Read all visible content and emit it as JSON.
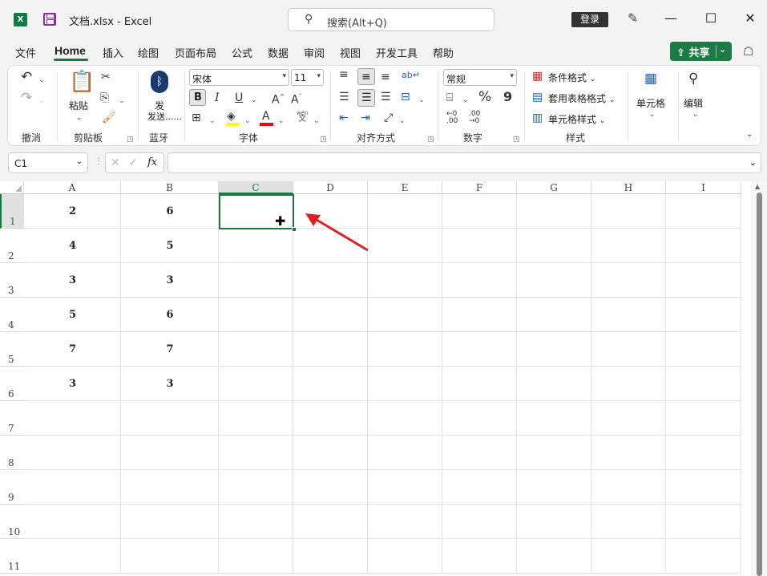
{
  "title_bar": {
    "doc_title": "文档.xlsx  -  Excel",
    "search_placeholder": "搜索(Alt+Q)",
    "login": "登录",
    "minimize": "—",
    "maximize": "☐",
    "close": "✕"
  },
  "menu": {
    "items": [
      "文件",
      "Home",
      "插入",
      "绘图",
      "页面布局",
      "公式",
      "数据",
      "审阅",
      "视图",
      "开发工具",
      "帮助"
    ],
    "active": "Home",
    "share": "共享"
  },
  "ribbon": {
    "groups": [
      "撤消",
      "剪贴板",
      "蓝牙",
      "字体",
      "对齐方式",
      "数字",
      "样式"
    ],
    "paste": "粘贴",
    "bluetooth_send": "发送......",
    "font_name": "宋体",
    "font_size": "11",
    "bold": "B",
    "italic": "I",
    "underline": "U",
    "number_format": "常规",
    "conditional_format": "条件格式",
    "table_format": "套用表格格式",
    "cell_style": "单元格样式",
    "cells": "单元格",
    "editing": "编辑",
    "percent": "%",
    "comma": "9",
    "wen": "wén",
    "wen_char": "文"
  },
  "formula_bar": {
    "name_box": "C1",
    "fx": "fx",
    "value": ""
  },
  "sheet": {
    "columns": [
      "A",
      "B",
      "C",
      "D",
      "E",
      "F",
      "G",
      "H",
      "I"
    ],
    "rows": [
      "1",
      "2",
      "3",
      "4",
      "5",
      "6",
      "7",
      "8",
      "9",
      "10",
      "11"
    ],
    "selected_cell": "C1",
    "data": [
      {
        "a": "2",
        "b": "6"
      },
      {
        "a": "4",
        "b": "5"
      },
      {
        "a": "3",
        "b": "3"
      },
      {
        "a": "5",
        "b": "6"
      },
      {
        "a": "7",
        "b": "7"
      },
      {
        "a": "3",
        "b": "3"
      }
    ]
  },
  "colors": {
    "accent": "#107c41",
    "arrow": "#e02020",
    "fill_highlight": "#ffff00",
    "font_color": "#ff0000"
  }
}
